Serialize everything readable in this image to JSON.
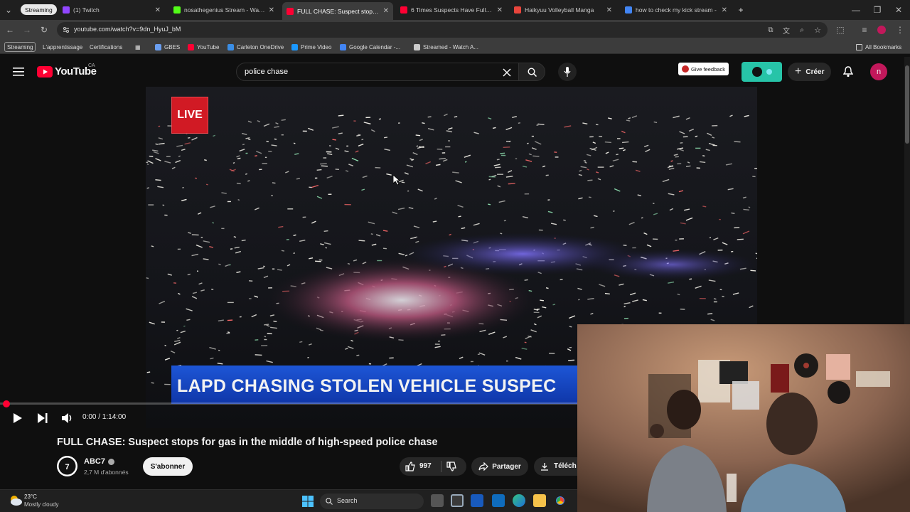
{
  "browser": {
    "group_label": "Streaming",
    "tabs": [
      {
        "label": "(1) Twitch",
        "fav_color": "#9146ff",
        "active": false
      },
      {
        "label": "nosathegenius Stream - Watch",
        "fav_color": "#53fc18",
        "active": false
      },
      {
        "label": "FULL CHASE: Suspect stops for",
        "fav_color": "#ff0033",
        "active": true
      },
      {
        "label": "6 Times Suspects Have Full-Blo",
        "fav_color": "#ff0033",
        "active": false
      },
      {
        "label": "Haikyuu Volleyball Manga",
        "fav_color": "#e8453c",
        "active": false
      },
      {
        "label": "how to check my kick stream -",
        "fav_color": "#4285f4",
        "active": false
      }
    ],
    "new_tab": "+",
    "url": "youtube.com/watch?v=9dn_HyuJ_bM",
    "bookmarks": [
      {
        "label": "Streaming",
        "pill": true
      },
      {
        "label": "L'apprentissage",
        "pill": false
      },
      {
        "label": "Certifications",
        "pill": false
      },
      {
        "label": "GBES",
        "icon_color": "#6a9ef0"
      },
      {
        "label": "YouTube",
        "icon_color": "#ff0033"
      },
      {
        "label": "Carleton OneDrive",
        "icon_color": "#3a8ee6"
      },
      {
        "label": "Prime Video",
        "icon_color": "#1a98ff"
      },
      {
        "label": "Google Calendar -...",
        "icon_color": "#4285f4"
      },
      {
        "label": "Streamed - Watch A...",
        "icon_color": "#cccccc"
      }
    ],
    "all_bookmarks": "All Bookmarks"
  },
  "youtube": {
    "logo_text": "YouTube",
    "region": "CA",
    "search_value": "police chase",
    "give_feedback": "Give feedback",
    "create_label": "Créer",
    "avatar_letter": "n",
    "accent": "#ff0033"
  },
  "video": {
    "live_label": "LIVE",
    "lower_third": "LAPD CHASING STOLEN VEHICLE SUSPEC",
    "time": "0:00 / 1:14:00",
    "progress": 0.0
  },
  "meta": {
    "title": "FULL CHASE: Suspect stops for gas in the middle of high-speed police chase",
    "channel": "ABC7",
    "subscribers": "2,7 M d'abonnés",
    "subscribe": "S'abonner",
    "likes": "997",
    "share": "Partager",
    "download": "Téléch"
  },
  "taskbar": {
    "temperature": "23°C",
    "weather": "Mostly cloudy",
    "search": "Search"
  }
}
